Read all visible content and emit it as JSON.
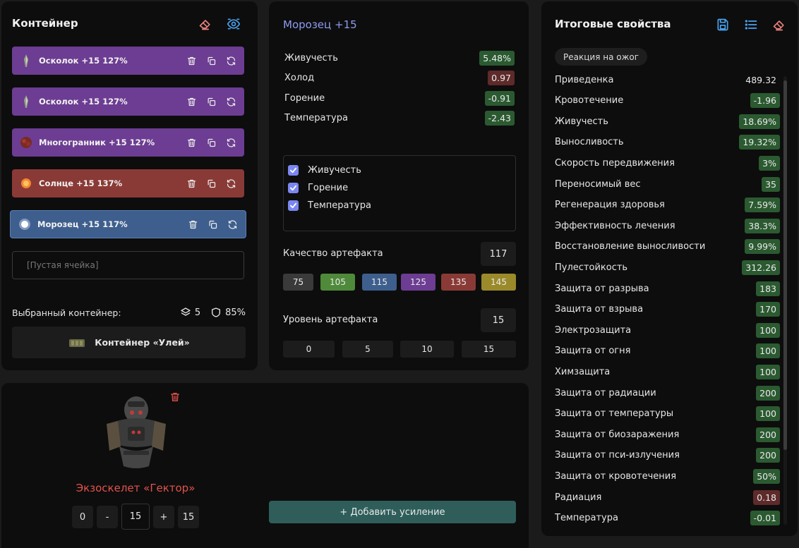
{
  "container": {
    "title": "Контейнер",
    "slots": [
      {
        "label": "Осколок +15 127%",
        "color": "#6c3d92"
      },
      {
        "label": "Осколок +15 127%",
        "color": "#6c3d92"
      },
      {
        "label": "Многогранник +15 127%",
        "color": "#6c3d92"
      },
      {
        "label": "Солнце +15 137%",
        "color": "#8a3a36"
      },
      {
        "label": "Морозец +15 117%",
        "color": "#3e5f8e"
      }
    ],
    "empty_slot": "[Пустая ячейка]",
    "selected_label": "Выбранный контейнер:",
    "slots_count": "5",
    "protection": "85%",
    "container_name": "Контейнер «Улей»"
  },
  "artifact": {
    "title": "Морозец +15",
    "stats": [
      {
        "name": "Живучесть",
        "value": "5.48%",
        "tone": "green"
      },
      {
        "name": "Холод",
        "value": "0.97",
        "tone": "red"
      },
      {
        "name": "Горение",
        "value": "-0.91",
        "tone": "green"
      },
      {
        "name": "Температура",
        "value": "-2.43",
        "tone": "green"
      }
    ],
    "checks": [
      "Живучесть",
      "Горение",
      "Температура"
    ],
    "quality_label": "Качество артефакта",
    "quality_value": "117",
    "quality_options": [
      {
        "label": "75",
        "color": "#3a3a3a"
      },
      {
        "label": "105",
        "color": "#4f8a3a"
      },
      {
        "label": "115",
        "color": "#3e5f8e"
      },
      {
        "label": "125",
        "color": "#6c3d92"
      },
      {
        "label": "135",
        "color": "#8a3a36"
      },
      {
        "label": "145",
        "color": "#9a8a2a"
      }
    ],
    "level_label": "Уровень артефакта",
    "level_value": "15",
    "level_options": [
      "0",
      "5",
      "10",
      "15"
    ]
  },
  "armor": {
    "name": "Экзоскелет «Гектор»",
    "min": "0",
    "minus": "-",
    "value": "15",
    "plus": "+",
    "max": "15",
    "add_button": "+ Добавить усиление"
  },
  "props": {
    "title": "Итоговые свойства",
    "chip": "Реакция на ожог",
    "rows": [
      {
        "name": "Приведенка",
        "value": "489.32",
        "tone": "plain"
      },
      {
        "name": "Кровотечение",
        "value": "-1.96",
        "tone": "green"
      },
      {
        "name": "Живучесть",
        "value": "18.69%",
        "tone": "green"
      },
      {
        "name": "Выносливость",
        "value": "19.32%",
        "tone": "green"
      },
      {
        "name": "Скорость передвижения",
        "value": "3%",
        "tone": "green"
      },
      {
        "name": "Переносимый вес",
        "value": "35",
        "tone": "green"
      },
      {
        "name": "Регенерация здоровья",
        "value": "7.59%",
        "tone": "green"
      },
      {
        "name": "Эффективность лечения",
        "value": "38.3%",
        "tone": "green"
      },
      {
        "name": "Восстановление выносливости",
        "value": "9.99%",
        "tone": "green"
      },
      {
        "name": "Пулестойкость",
        "value": "312.26",
        "tone": "green"
      },
      {
        "name": "Защита от разрыва",
        "value": "183",
        "tone": "green"
      },
      {
        "name": "Защита от взрыва",
        "value": "170",
        "tone": "green"
      },
      {
        "name": "Электрозащита",
        "value": "100",
        "tone": "green"
      },
      {
        "name": "Защита от огня",
        "value": "100",
        "tone": "green"
      },
      {
        "name": "Химзащита",
        "value": "100",
        "tone": "green"
      },
      {
        "name": "Защита от радиации",
        "value": "200",
        "tone": "green"
      },
      {
        "name": "Защита от температуры",
        "value": "100",
        "tone": "green"
      },
      {
        "name": "Защита от биозаражения",
        "value": "200",
        "tone": "green"
      },
      {
        "name": "Защита от пси-излучения",
        "value": "200",
        "tone": "green"
      },
      {
        "name": "Защита от кровотечения",
        "value": "50%",
        "tone": "green"
      },
      {
        "name": "Радиация",
        "value": "0.18",
        "tone": "red"
      },
      {
        "name": "Температура",
        "value": "-0.01",
        "tone": "green"
      }
    ]
  },
  "icons": {
    "eraser": "eraser-icon",
    "eye": "eye-icon",
    "save": "save-icon",
    "list": "list-icon",
    "trash": "trash-icon",
    "copy": "copy-icon",
    "refresh": "refresh-icon",
    "layers": "layers-icon",
    "shield": "shield-icon"
  },
  "colors": {
    "accent": "#8d9cf0",
    "green_badge": "#2b5a31",
    "red_badge": "#5e2a2a",
    "armor_name": "#e2524b",
    "add_button": "#2f5e5a"
  }
}
